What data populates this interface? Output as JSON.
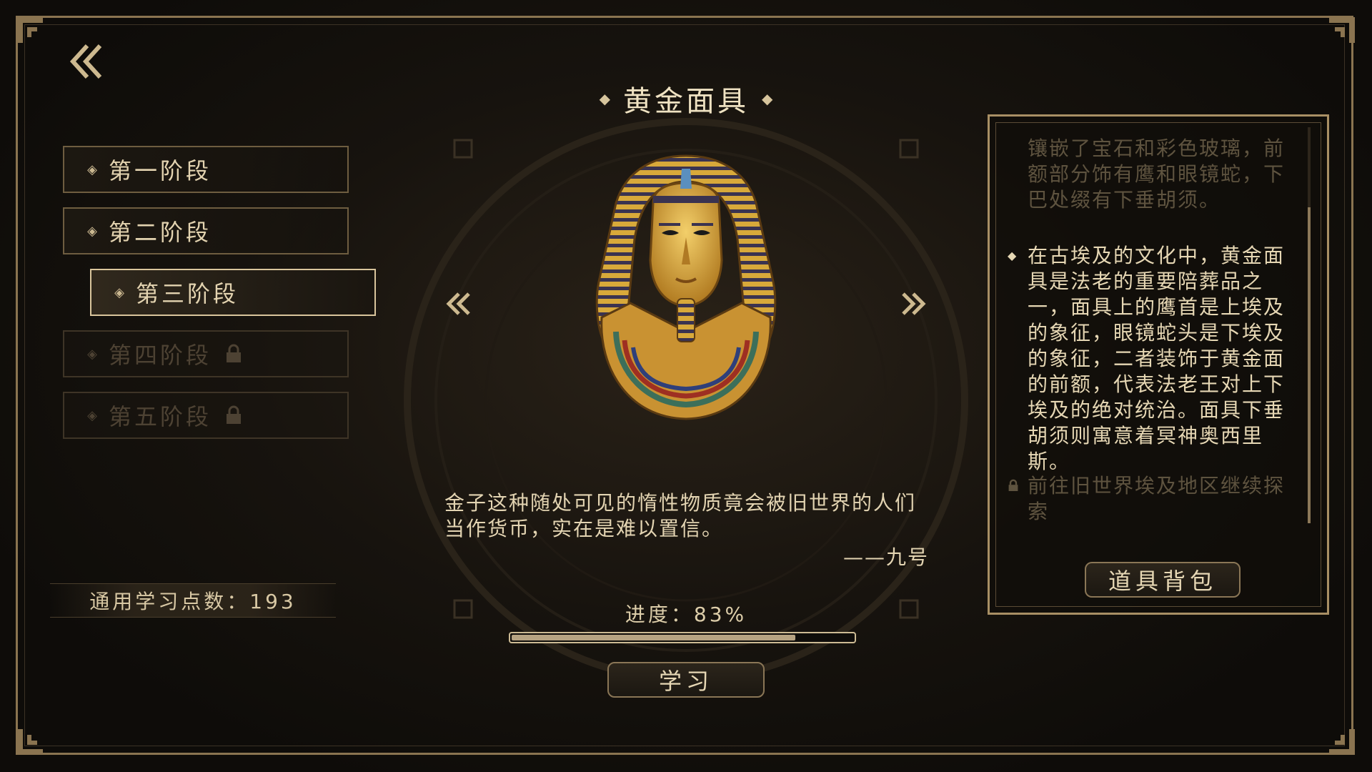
{
  "item": {
    "title": "黄金面具",
    "quote": "金子这种随处可见的惰性物质竟会被旧世界的人们当作货币，实在是难以置信。",
    "quote_author": "——九号"
  },
  "stages": [
    {
      "label": "第一阶段",
      "state": "normal"
    },
    {
      "label": "第二阶段",
      "state": "normal"
    },
    {
      "label": "第三阶段",
      "state": "active"
    },
    {
      "label": "第四阶段",
      "state": "locked"
    },
    {
      "label": "第五阶段",
      "state": "locked"
    }
  ],
  "points": {
    "label": "通用学习点数：193"
  },
  "progress": {
    "label": "进度：83%",
    "value": 0.83
  },
  "buttons": {
    "learn": "学习",
    "bag": "道具背包"
  },
  "description": {
    "paragraph_top": "镶嵌了宝石和彩色玻璃，前额部分饰有鹰和眼镜蛇，下巴处缀有下垂胡须。",
    "paragraph_main": "在古埃及的文化中，黄金面具是法老的重要陪葬品之一，面具上的鹰首是上埃及的象征，眼镜蛇头是下埃及的象征，二者装饰于黄金面的前额，代表法老王对上下埃及的绝对统治。面具下垂胡须则寓意着冥神奥西里斯。",
    "paragraph_locked": "前往旧世界埃及地区继续探索"
  },
  "icons": {
    "back": "double-chevron-left-icon",
    "prev": "double-chevron-left-icon",
    "next": "double-chevron-right-icon",
    "lock": "lock-icon",
    "bullet": "diamond-icon"
  },
  "colors": {
    "gold": "#d9c59c",
    "border": "#8a7450",
    "background": "#0c0a08"
  }
}
